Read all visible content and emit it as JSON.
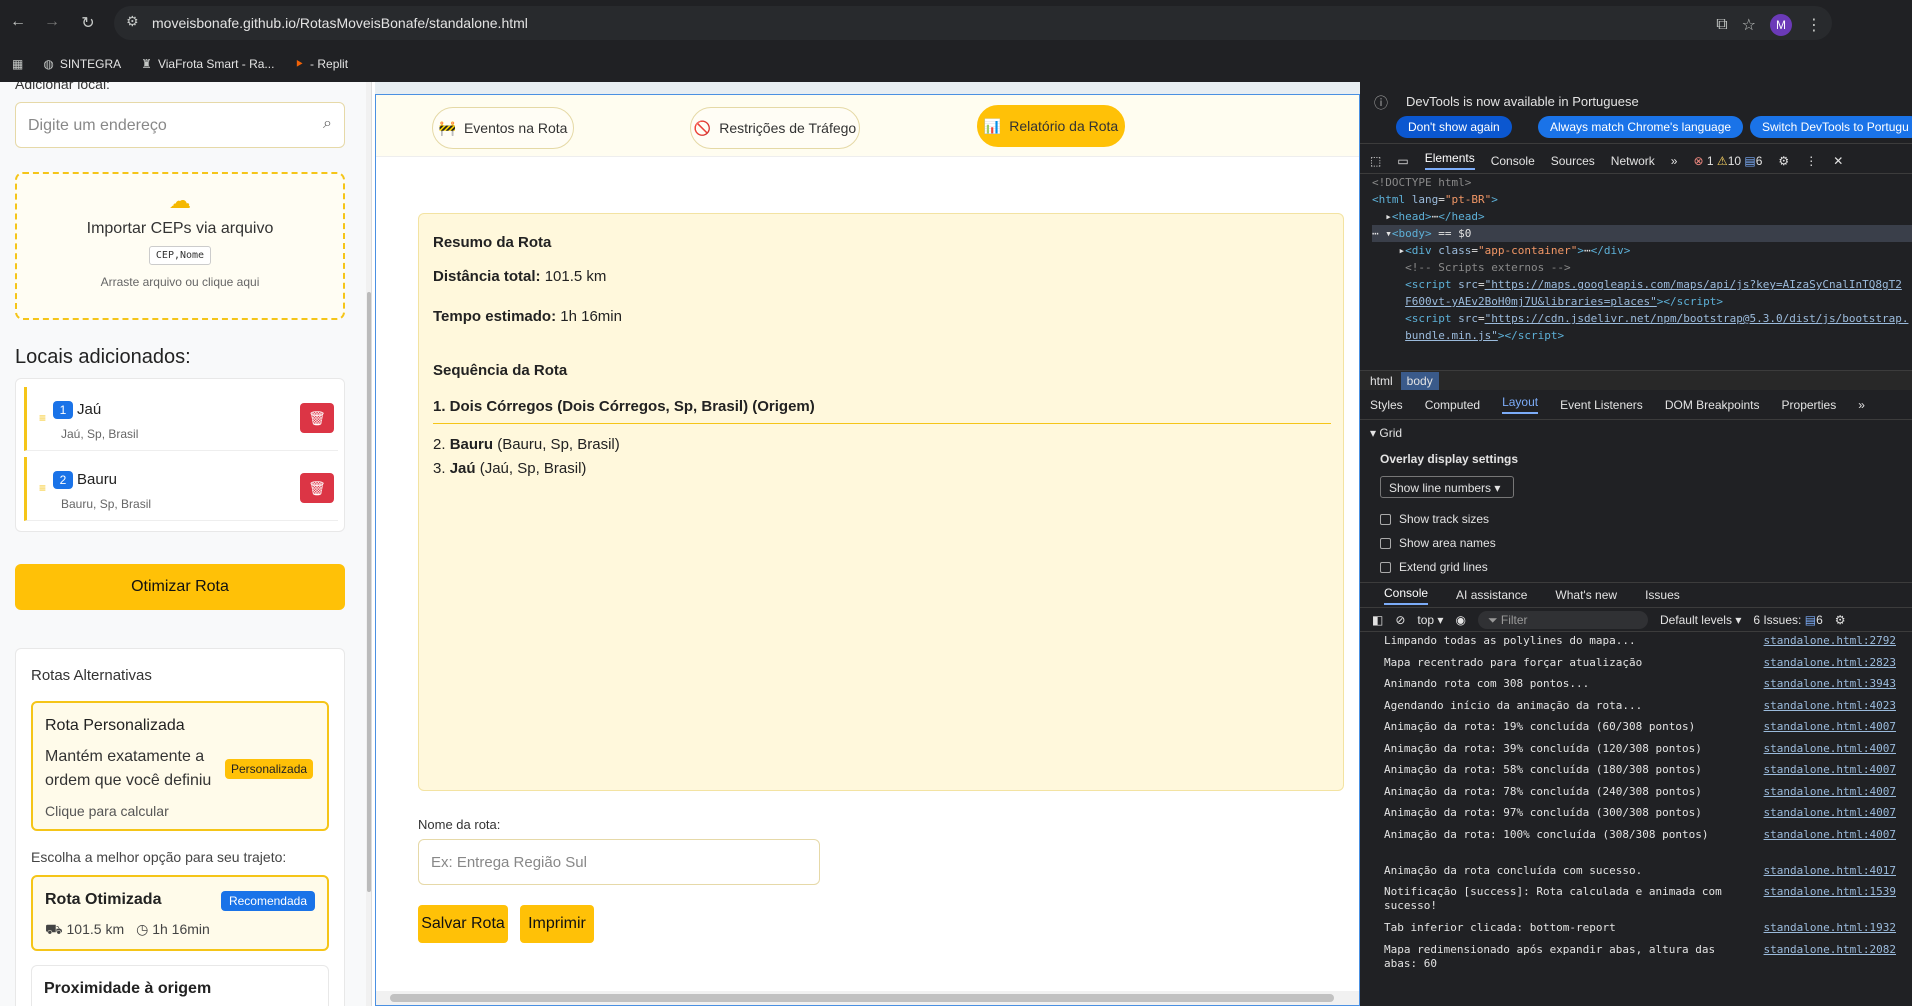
{
  "browser": {
    "url": "moveisbonafe.github.io/RotasMoveisBonafe/standalone.html",
    "avatar": "M",
    "bookmarks": [
      "SINTEGRA",
      "ViaFrota Smart - Ra...",
      "- Replit"
    ]
  },
  "sidebar": {
    "cut_label": "Adicionar local:",
    "address_placeholder": "Digite um endereço",
    "import_title": "Importar CEPs via arquivo",
    "import_code": "CEP,Nome",
    "import_hint": "Arraste arquivo ou clique aqui",
    "locations_title": "Locais adicionados:",
    "locations": [
      {
        "num": "1",
        "name": "Jaú",
        "sub": "Jaú, Sp, Brasil"
      },
      {
        "num": "2",
        "name": "Bauru",
        "sub": "Bauru, Sp, Brasil"
      }
    ],
    "optimize_label": "Otimizar Rota",
    "alternatives_title": "Rotas Alternativas",
    "custom": {
      "title": "Rota Personalizada",
      "desc": "Mantém exatamente a ordem que você definiu",
      "badge": "Personalizada",
      "calc": "Clique para calcular"
    },
    "choose_label": "Escolha a melhor opção para seu trajeto:",
    "optimized": {
      "title": "Rota Otimizada",
      "badge": "Recomendada",
      "distance": "101.5 km",
      "time": "1h 16min"
    },
    "proximity_title": "Proximidade à origem"
  },
  "main": {
    "tabs": [
      {
        "label": "Eventos na Rota",
        "icon": "🚧"
      },
      {
        "label": "Restrições de Tráfego",
        "icon": "🚫"
      },
      {
        "label": "Relatório da Rota",
        "icon": "📊"
      }
    ],
    "report": {
      "summary_title": "Resumo da Rota",
      "distance_label": "Distância total:",
      "distance_value": "101.5 km",
      "time_label": "Tempo estimado:",
      "time_value": "1h 16min",
      "sequence_title": "Sequência da Rota",
      "origin": "1. Dois Córregos (Dois Córregos, Sp, Brasil) (Origem)",
      "stops": [
        {
          "num": "2.",
          "name": "Bauru",
          "detail": "(Bauru, Sp, Brasil)"
        },
        {
          "num": "3.",
          "name": "Jaú",
          "detail": "(Jaú, Sp, Brasil)"
        }
      ]
    },
    "route_name_label": "Nome da rota:",
    "route_name_placeholder": "Ex: Entrega Região Sul",
    "save_label": "Salvar Rota",
    "print_label": "Imprimir"
  },
  "devtools": {
    "notice": "DevTools is now available in Portuguese",
    "btn_dont_show": "Don't show again",
    "btn_match": "Always match Chrome's language",
    "btn_switch": "Switch DevTools to Portugu",
    "tabs": [
      "Elements",
      "Console",
      "Sources",
      "Network"
    ],
    "counts": {
      "errors": "1",
      "warnings": "10",
      "info": "6"
    },
    "crumbs": [
      "html",
      "body"
    ],
    "panel_tabs": [
      "Styles",
      "Computed",
      "Layout",
      "Event Listeners",
      "DOM Breakpoints",
      "Properties"
    ],
    "grid_label": "Grid",
    "overlay_title": "Overlay display settings",
    "show_line_numbers": "Show line numbers",
    "checkboxes": [
      "Show track sizes",
      "Show area names",
      "Extend grid lines"
    ],
    "console_tabs": [
      "Console",
      "AI assistance",
      "What's new",
      "Issues"
    ],
    "context": "top",
    "filter": "Filter",
    "levels": "Default levels",
    "issues": "6 Issues:",
    "issues_count": "6",
    "logs": [
      {
        "msg": "Limpando todas as polylines do mapa...",
        "src": "standalone.html:2792"
      },
      {
        "msg": "Mapa recentrado para forçar atualização",
        "src": "standalone.html:2823"
      },
      {
        "msg": "Animando rota com 308 pontos...",
        "src": "standalone.html:3943"
      },
      {
        "msg": "Agendando início da animação da rota...",
        "src": "standalone.html:4023"
      },
      {
        "msg": "Animação da rota: 19% concluída (60/308 pontos)",
        "src": "standalone.html:4007"
      },
      {
        "msg": "Animação da rota: 39% concluída (120/308 pontos)",
        "src": "standalone.html:4007"
      },
      {
        "msg": "Animação da rota: 58% concluída (180/308 pontos)",
        "src": "standalone.html:4007"
      },
      {
        "msg": "Animação da rota: 78% concluída (240/308 pontos)",
        "src": "standalone.html:4007"
      },
      {
        "msg": "Animação da rota: 97% concluída (300/308 pontos)",
        "src": "standalone.html:4007"
      },
      {
        "msg": "Animação da rota: 100% concluída (308/308 pontos)",
        "src": "standalone.html:4007"
      },
      {
        "msg": "Animação da rota concluída com sucesso.",
        "src": "standalone.html:4017"
      },
      {
        "msg": "Notificação [success]: Rota calculada e animada com sucesso!",
        "src": "standalone.html:1539"
      },
      {
        "msg": "Tab inferior clicada: bottom-report",
        "src": "standalone.html:1932"
      },
      {
        "msg": "Mapa redimensionado após expandir abas, altura das abas: 60",
        "src": "standalone.html:2082"
      }
    ]
  }
}
